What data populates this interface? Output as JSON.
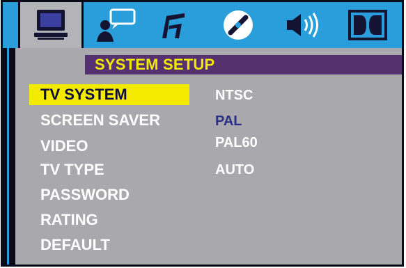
{
  "title": "SYSTEM SETUP",
  "tabs": [
    {
      "name": "system",
      "icon": "monitor-icon",
      "active": true
    },
    {
      "name": "language",
      "icon": "person-speech-icon",
      "active": false
    },
    {
      "name": "audio",
      "icon": "music-note-icon",
      "active": false
    },
    {
      "name": "video",
      "icon": "disc-icon",
      "active": false
    },
    {
      "name": "speaker",
      "icon": "speaker-icon",
      "active": false
    },
    {
      "name": "dolby",
      "icon": "dolby-icon",
      "active": false
    }
  ],
  "menu_items": [
    "TV SYSTEM",
    "SCREEN SAVER",
    "VIDEO",
    "TV TYPE",
    "PASSWORD",
    "RATING",
    "DEFAULT"
  ],
  "selected_item": "TV SYSTEM",
  "options": [
    "NTSC",
    "PAL",
    "PAL60",
    "AUTO"
  ],
  "current_option": "PAL",
  "colors": {
    "icon_bar": "#2a9ddb",
    "panel": "#a9a9ad",
    "title_bar": "#55326f",
    "title_text": "#f1ea00",
    "highlight": "#f4ea00",
    "current_option": "#2b2f86"
  }
}
